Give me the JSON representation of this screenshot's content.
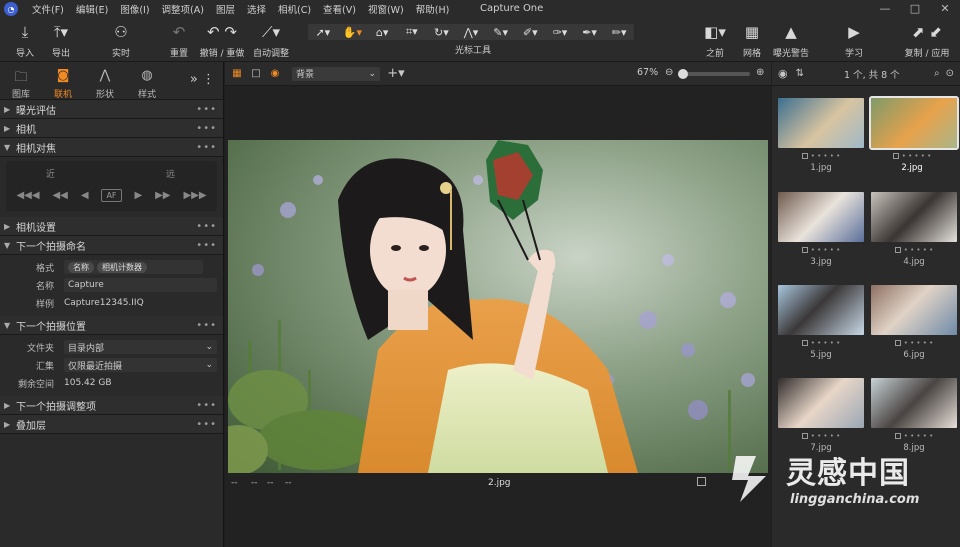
{
  "menubar": {
    "items": [
      "文件(F)",
      "编辑(E)",
      "图像(I)",
      "调整项(A)",
      "图层",
      "选择",
      "相机(C)",
      "查看(V)",
      "视窗(W)",
      "帮助(H)"
    ],
    "app_title": "Capture One"
  },
  "toolbar": {
    "import": "导入",
    "export": "导出",
    "live": "实时",
    "reset": "重置",
    "undo_redo": "撤销 / 重做",
    "auto_adjust": "自动调整",
    "cursor_tools": "光标工具",
    "before": "之前",
    "grid": "网格",
    "exposure_warning": "曝光警告",
    "learn": "学习",
    "copy_apply": "复制 / 应用"
  },
  "left_panel": {
    "tabs": [
      {
        "label": "图库",
        "icon": "folder-icon"
      },
      {
        "label": "联机",
        "icon": "camera-icon"
      },
      {
        "label": "形状",
        "icon": "shape-icon"
      },
      {
        "label": "样式",
        "icon": "style-icon"
      }
    ],
    "sections": {
      "exposure_eval": "曝光评估",
      "camera": "相机",
      "camera_focus": "相机对焦",
      "camera_settings": "相机设置",
      "next_naming": "下一个拍摄命名",
      "next_location": "下一个拍摄位置",
      "next_adjustments": "下一个拍摄调整项",
      "overlay": "叠加层"
    },
    "focus": {
      "near": "近",
      "far": "远",
      "af": "AF"
    },
    "naming": {
      "format_label": "格式",
      "format_chips": [
        "名称",
        "相机计数器"
      ],
      "name_label": "名称",
      "name_value": "Capture",
      "sample_label": "样例",
      "sample_value": "Capture12345.IIQ"
    },
    "location": {
      "folder_label": "文件夹",
      "folder_value": "目录内部",
      "collection_label": "汇集",
      "collection_value": "仅限最近拍摄",
      "space_label": "剩余空间",
      "space_value": "105.42 GB"
    }
  },
  "viewer": {
    "layer_select": "背景",
    "zoom": "67%",
    "zoom_level": 0,
    "filename": "2.jpg",
    "status_left": [
      "--",
      "--",
      "--",
      "--"
    ]
  },
  "browser": {
    "count": "1 个, 共 8 个",
    "thumbs": [
      {
        "name": "1.jpg",
        "selected": false
      },
      {
        "name": "2.jpg",
        "selected": true
      },
      {
        "name": "3.jpg",
        "selected": false
      },
      {
        "name": "4.jpg",
        "selected": false
      },
      {
        "name": "5.jpg",
        "selected": false
      },
      {
        "name": "6.jpg",
        "selected": false
      },
      {
        "name": "7.jpg",
        "selected": false
      },
      {
        "name": "8.jpg",
        "selected": false
      }
    ]
  },
  "watermark": {
    "brand": "灵感中国",
    "url": "lingganchina.com"
  },
  "colors": {
    "accent": "#f08a24",
    "panel": "#2a2a2a",
    "bg": "#1e1e1e"
  }
}
